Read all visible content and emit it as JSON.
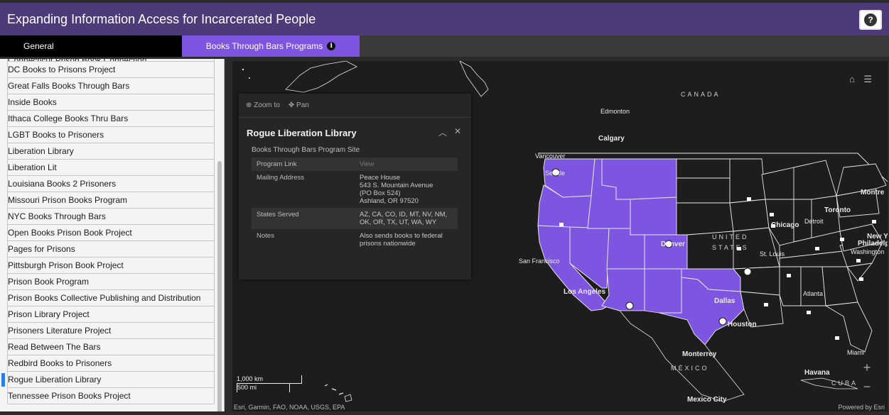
{
  "header": {
    "title": "Expanding Information Access for Incarcerated People",
    "help_label": "?"
  },
  "tabs": [
    {
      "label": "General"
    },
    {
      "label": "Books Through Bars Programs",
      "info": "i"
    }
  ],
  "sidebar": {
    "items": [
      {
        "label": "Connecticut Prison Book Connection"
      },
      {
        "label": "DC Books to Prisons Project"
      },
      {
        "label": "Great Falls Books Through Bars"
      },
      {
        "label": "Inside Books"
      },
      {
        "label": "Ithaca College Books Thru Bars"
      },
      {
        "label": "LGBT Books to Prisoners"
      },
      {
        "label": "Liberation Library"
      },
      {
        "label": "Liberation Lit"
      },
      {
        "label": "Louisiana Books 2 Prisoners"
      },
      {
        "label": "Missouri Prison Books Program"
      },
      {
        "label": "NYC Books Through Bars"
      },
      {
        "label": "Open Books Prison Book Project"
      },
      {
        "label": "Pages for Prisons"
      },
      {
        "label": "Pittsburgh Prison Book Project"
      },
      {
        "label": "Prison Book Program"
      },
      {
        "label": "Prison Books Collective Publishing and Distribution"
      },
      {
        "label": "Prison Library Project"
      },
      {
        "label": "Prisoners Literature Project"
      },
      {
        "label": "Read Between The Bars"
      },
      {
        "label": "Redbird Books to Prisoners"
      },
      {
        "label": "Rogue Liberation Library"
      },
      {
        "label": "Tennessee Prison Books Project"
      }
    ],
    "selected": "Rogue Liberation Library"
  },
  "popup": {
    "zoom_label": "Zoom to",
    "pan_label": "Pan",
    "title": "Rogue Liberation Library",
    "subtitle": "Books Through Bars Program Site",
    "fields": {
      "program_link_key": "Program Link",
      "program_link_value": "View",
      "mailing_key": "Mailing Address",
      "mailing_line1": "Peace House",
      "mailing_line2": "543 S. Mountain Avenue",
      "mailing_line3": "(PO Box 524)",
      "mailing_line4": "Ashland, OR 97520",
      "states_key": "States Served",
      "states_line1": "AZ, CA, CO, ID, MT, NV, NM,",
      "states_line2": "OK, OR, TX, UT, WA, WY",
      "notes_key": "Notes",
      "notes_line1": "Also sends books to federal",
      "notes_line2": "prisons nationwide"
    }
  },
  "map": {
    "labels": {
      "canada": "CANADA",
      "edmonton": "Edmonton",
      "calgary": "Calgary",
      "vancouver": "Vancouver",
      "seattle": "Seattle",
      "montreal": "Montre",
      "toronto": "Toronto",
      "chicago": "Chicago",
      "detroit": "Detroit",
      "new_york": "New Yor",
      "philadelphia": "Philadelphia",
      "washington": "Washington",
      "united": "UNITED",
      "states": "STATES",
      "denver": "Denver",
      "st_louis": "St. Louis",
      "san_francisco": "San Francisco",
      "los_angeles": "Los Angeles",
      "atlanta": "Atlanta",
      "dallas": "Dallas",
      "houston": "Houston",
      "monterrey": "Monterrey",
      "mexico": "MÉXICO",
      "miami": "Miami",
      "havana": "Havana",
      "cuba": "CUBA",
      "mexico_city": "Mexico City"
    },
    "scale_km": "1,000 km",
    "scale_mi": "500 mi",
    "attribution": "Esri, Garmin, FAO, NOAA, USGS, EPA",
    "powered_by": "Powered by Esri",
    "zoom_in": "+",
    "zoom_out": "−",
    "colors": {
      "served": "#7d55e0",
      "land": "#1d1d1d",
      "borders": "#e6e6e6"
    }
  }
}
